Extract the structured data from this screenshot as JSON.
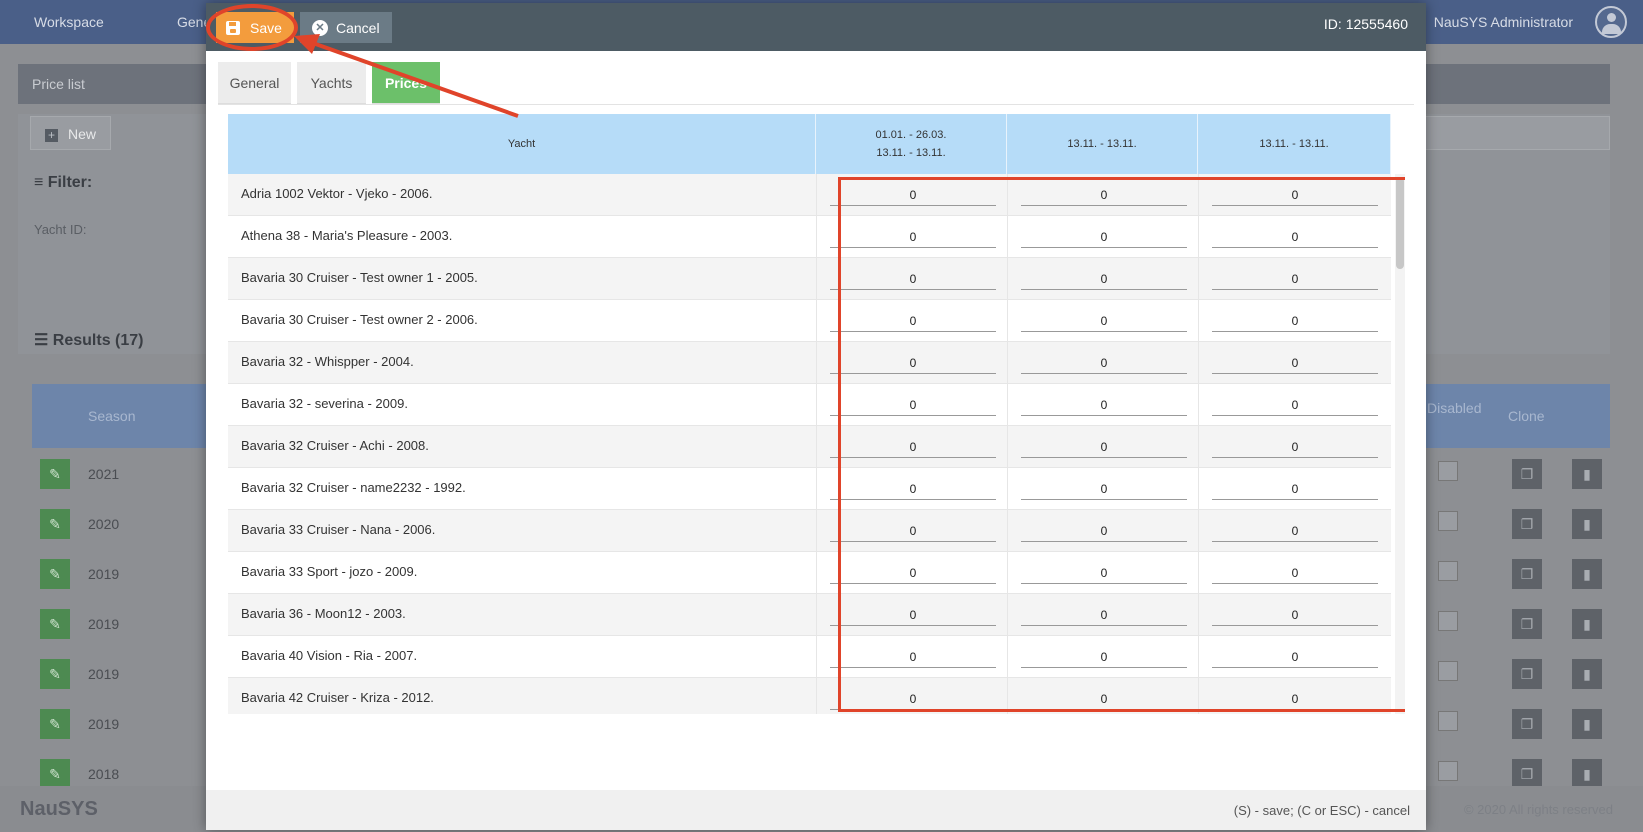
{
  "background": {
    "nav": [
      "Workspace",
      "Gene"
    ],
    "admin_name": "NauSYS Administrator",
    "panel_title": "Price list",
    "new_label": "New",
    "filter_label": "Filter:",
    "yacht_id_label": "Yacht ID:",
    "results_label": "Results (17)",
    "table_headers": {
      "season": "Season",
      "disabled": "Disabled",
      "clone": "Clone"
    },
    "rows": [
      {
        "season": "2021"
      },
      {
        "season": "2020"
      },
      {
        "season": "2019"
      },
      {
        "season": "2019"
      },
      {
        "season": "2019"
      },
      {
        "season": "2019"
      },
      {
        "season": "2018"
      }
    ],
    "logo": "NauSYS",
    "copyright": "© 2020 All rights reserved"
  },
  "modal": {
    "save_label": "Save",
    "cancel_label": "Cancel",
    "id_text": "ID: 12555460",
    "tabs": [
      {
        "label": "General",
        "active": false
      },
      {
        "label": "Yachts",
        "active": false
      },
      {
        "label": "Prices",
        "active": true
      }
    ],
    "grid": {
      "columns": [
        "Yacht",
        "01.01. - 26.03.",
        "13.11. - 13.11.",
        "13.11. - 13.11."
      ],
      "column1_line2": "13.11. - 13.11.",
      "rows": [
        {
          "yacht": "Adria 1002 Vektor - Vjeko - 2006.",
          "prices": [
            "0",
            "0",
            "0"
          ]
        },
        {
          "yacht": "Athena 38 - Maria's Pleasure - 2003.",
          "prices": [
            "0",
            "0",
            "0"
          ]
        },
        {
          "yacht": "Bavaria 30 Cruiser - Test owner 1 - 2005.",
          "prices": [
            "0",
            "0",
            "0"
          ]
        },
        {
          "yacht": "Bavaria 30 Cruiser - Test owner 2 - 2006.",
          "prices": [
            "0",
            "0",
            "0"
          ]
        },
        {
          "yacht": "Bavaria 32 - Whispper - 2004.",
          "prices": [
            "0",
            "0",
            "0"
          ]
        },
        {
          "yacht": "Bavaria 32 - severina - 2009.",
          "prices": [
            "0",
            "0",
            "0"
          ]
        },
        {
          "yacht": "Bavaria 32 Cruiser - Achi - 2008.",
          "prices": [
            "0",
            "0",
            "0"
          ]
        },
        {
          "yacht": "Bavaria 32 Cruiser - name2232 - 1992.",
          "prices": [
            "0",
            "0",
            "0"
          ]
        },
        {
          "yacht": "Bavaria 33 Cruiser - Nana - 2006.",
          "prices": [
            "0",
            "0",
            "0"
          ]
        },
        {
          "yacht": "Bavaria 33 Sport - jozo - 2009.",
          "prices": [
            "0",
            "0",
            "0"
          ]
        },
        {
          "yacht": "Bavaria 36 - Moon12 - 2003.",
          "prices": [
            "0",
            "0",
            "0"
          ]
        },
        {
          "yacht": "Bavaria 40 Vision - Ria - 2007.",
          "prices": [
            "0",
            "0",
            "0"
          ]
        },
        {
          "yacht": "Bavaria 42 Cruiser - Kriza - 2012.",
          "prices": [
            "0",
            "0",
            "0"
          ]
        }
      ]
    },
    "footer_hint": "(S) - save; (C or ESC) - cancel"
  },
  "colors": {
    "header": "#4d5b64",
    "save_button": "#f39c3d",
    "active_tab": "#6cc06a",
    "grid_header": "#b6dcf8",
    "annotation": "#e0442a"
  },
  "icons": [
    "floppy-disk-icon",
    "close-circle-icon",
    "plus-icon",
    "filter-icon",
    "list-icon",
    "pencil-icon",
    "copy-icon",
    "trash-icon",
    "user-icon"
  ]
}
